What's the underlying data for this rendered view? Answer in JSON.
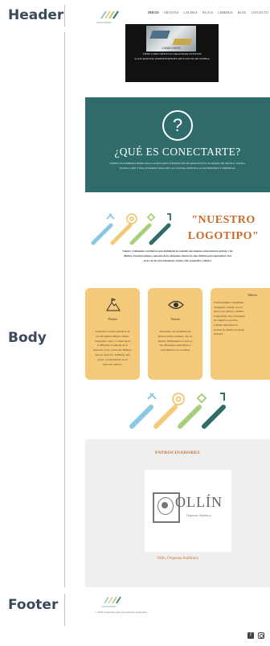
{
  "side_labels": {
    "header": "Header",
    "body": "Body",
    "footer": "Footer"
  },
  "logo": {
    "text": "conectarte"
  },
  "nav": {
    "items": [
      "INICIO",
      "ARTISTAS",
      "GALERIA",
      "BLOGS",
      "LIBRERIA",
      "BLOG",
      "CONTACTO"
    ]
  },
  "hero": {
    "banner_text": "CONECTARTE",
    "caption_line1": "TIENE COMO OBJETIVO ORGANIZAR EVENTOS",
    "caption_line2": "A LOS ARTISTAS INDEPENDIENTES RECLUSIVOS DE PUEBLA"
  },
  "about": {
    "symbol": "?",
    "title": "¿QUÉ ES CONECTARTE?",
    "text_line1": "SOMOS UNA EMPRESA DEDICADA A LA DIFUSIÓN Y PROMOCIÓN DE ARTISTAS EN LAS RAMAS DE: MÚSICA, DANZA,",
    "text_line2": "TEATRO, CINE Y MAS. ESTAMOS CERCA DE LA CULTURA ARTÍSTICA A LAS PERSONAS Y EMPRESAS."
  },
  "logo_section": {
    "title_line1": "\"NUESTRO",
    "title_line2": "LOGOTIPO\"",
    "desc_line1": "Nuestro 4 elementos correlativos que simbolizan la conexión que tenemos entre nuestros artistas y las",
    "desc_line2": "clientes. Al mismo tiempo, cada uno de los elementos tienen un color distinto para representar a los",
    "desc_line3": "artes con las que trabajamos: danza, cine, fotografía y música."
  },
  "cards": [
    {
      "title": "Visión",
      "lines": [
        "Gestionar eventos artísticos en",
        "las disciplinas música, danza,",
        "fotografía y cine. Lo ideal hacer",
        "la difusión localizada en el",
        "mercado local y nacional. Brindar",
        "nuevos espacios. También, esto",
        "apoyo a posicionarse en el",
        "mercado laboral."
      ]
    },
    {
      "title": "Visión",
      "lines": [
        "Tan buena con diseñados de",
        "puesta artística número uno en",
        "Puebla. Difundiendo el arte en",
        "sus diferentes expresiones y",
        "acercándolo a la sociedad."
      ]
    },
    {
      "title": "Valores",
      "lines": [
        "Profesionalismo: Cumplimos",
        "entregando a tiempo con las",
        "tareas a los artistas y clientes.",
        "Compromiso: Nos esforzamos",
        "en cumplir lo acordado.",
        "Calidad: Ofrecemos un",
        "servicio de calidad con buena",
        "atención."
      ]
    }
  ],
  "sponsors": {
    "heading": "PATROCINADORES",
    "sponsor_name": "OLLÍN",
    "sponsor_sub": "Orquesta Sinfónica",
    "caption": "Ollín, Orquesta Sinfónica"
  },
  "footer": {
    "logo_text": "conectarte",
    "copyright": "© 2018 Conectarte todos los derechos reservados.",
    "social": [
      "facebook-icon",
      "instagram-icon"
    ]
  },
  "colors": {
    "teal": "#2e6b6a",
    "yellow": "#f4c97a",
    "blue": "#8ac8e6",
    "green": "#a9cf7a",
    "dark": "#3a4a5c"
  }
}
